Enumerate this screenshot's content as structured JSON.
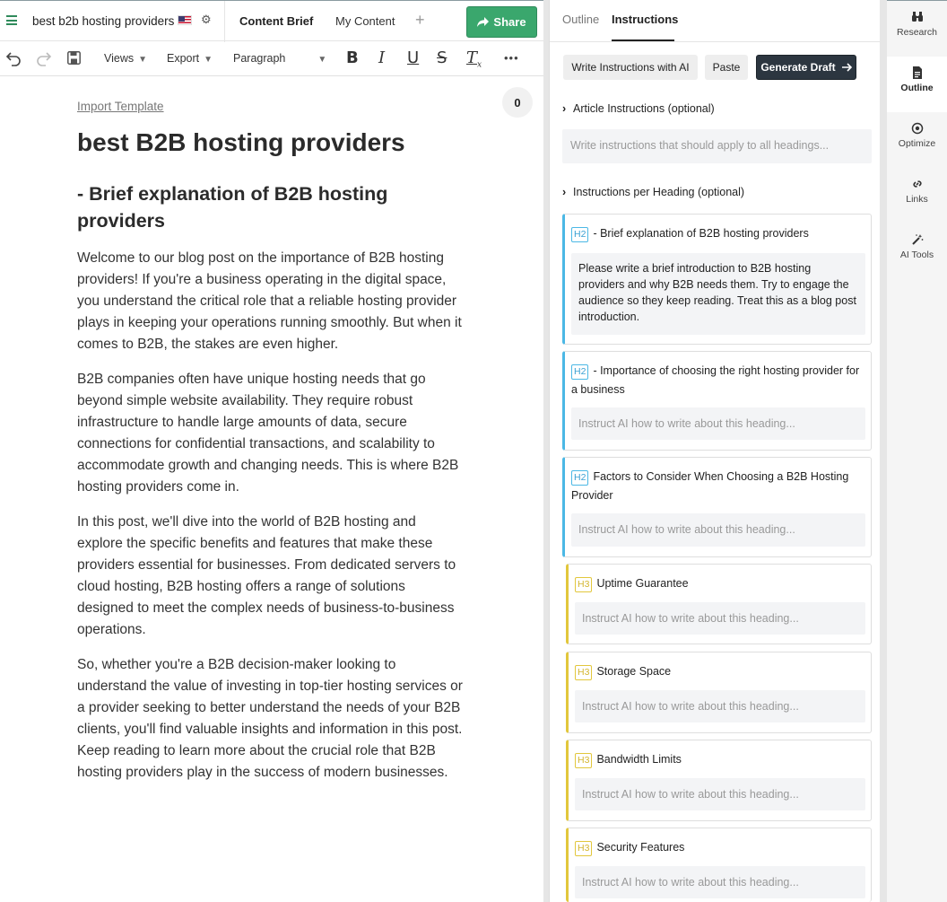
{
  "topbar": {
    "doc_title": "best b2b hosting providers",
    "tab_brief": "Content Brief",
    "tab_content": "My Content",
    "add_tab": "+",
    "share_label": "Share"
  },
  "toolbar": {
    "views_label": "Views",
    "export_label": "Export",
    "paragraph_label": "Paragraph",
    "more_label": "•••"
  },
  "document": {
    "import_template": "Import Template",
    "counter": "0",
    "h1": "best B2B hosting providers",
    "h2": "- Brief explanation of B2B hosting providers",
    "paragraphs": [
      "Welcome to our blog post on the importance of B2B hosting providers! If you're a business operating in the digital space, you understand the critical role that a reliable hosting provider plays in keeping your operations running smoothly. But when it comes to B2B, the stakes are even higher.",
      "B2B companies often have unique hosting needs that go beyond simple website availability. They require robust infrastructure to handle large amounts of data, secure connections for confidential transactions, and scalability to accommodate growth and changing needs. This is where B2B hosting providers come in.",
      "In this post, we'll dive into the world of B2B hosting and explore the specific benefits and features that make these providers essential for businesses. From dedicated servers to cloud hosting, B2B hosting offers a range of solutions designed to meet the complex needs of business-to-business operations.",
      "So, whether you're a B2B decision-maker looking to understand the value of investing in top-tier hosting services or a provider seeking to better understand the needs of your B2B clients, you'll find valuable insights and information in this post. Keep reading to learn more about the crucial role that B2B hosting providers play in the success of modern businesses."
    ]
  },
  "panel": {
    "tab_outline": "Outline",
    "tab_instructions": "Instructions",
    "btn_write_ai": "Write Instructions with AI",
    "btn_paste": "Paste",
    "btn_generate": "Generate Draft",
    "article_section": "Article Instructions (optional)",
    "article_placeholder": "Write instructions that should apply to all headings...",
    "per_heading_section": "Instructions per Heading (optional)",
    "headings": [
      {
        "level": "H2",
        "title": "- Brief explanation of B2B hosting providers",
        "instruction": "Please write a brief introduction to B2B hosting providers and why B2B needs them. Try to engage the audience so they keep reading. Treat this as a blog post introduction.",
        "placeholder": ""
      },
      {
        "level": "H2",
        "title": "- Importance of choosing the right hosting provider for a business",
        "instruction": "",
        "placeholder": "Instruct AI how to write about this heading..."
      },
      {
        "level": "H2",
        "title": "Factors to Consider When Choosing a B2B Hosting Provider",
        "instruction": "",
        "placeholder": "Instruct AI how to write about this heading..."
      },
      {
        "level": "H3",
        "title": "Uptime Guarantee",
        "instruction": "",
        "placeholder": "Instruct AI how to write about this heading..."
      },
      {
        "level": "H3",
        "title": "Storage Space",
        "instruction": "",
        "placeholder": "Instruct AI how to write about this heading..."
      },
      {
        "level": "H3",
        "title": "Bandwidth Limits",
        "instruction": "",
        "placeholder": "Instruct AI how to write about this heading..."
      },
      {
        "level": "H3",
        "title": "Security Features",
        "instruction": "",
        "placeholder": "Instruct AI how to write about this heading..."
      }
    ]
  },
  "rail": {
    "items": [
      {
        "label": "Research",
        "icon": "binoculars-icon"
      },
      {
        "label": "Outline",
        "icon": "document-icon"
      },
      {
        "label": "Optimize",
        "icon": "target-icon"
      },
      {
        "label": "Links",
        "icon": "link-icon"
      },
      {
        "label": "AI Tools",
        "icon": "magic-wand-icon"
      }
    ]
  },
  "colors": {
    "share_green": "#3aa76d",
    "h2_blue": "#4bb8e5",
    "h3_yellow": "#e2c73c",
    "generate_dark": "#2c3640"
  }
}
